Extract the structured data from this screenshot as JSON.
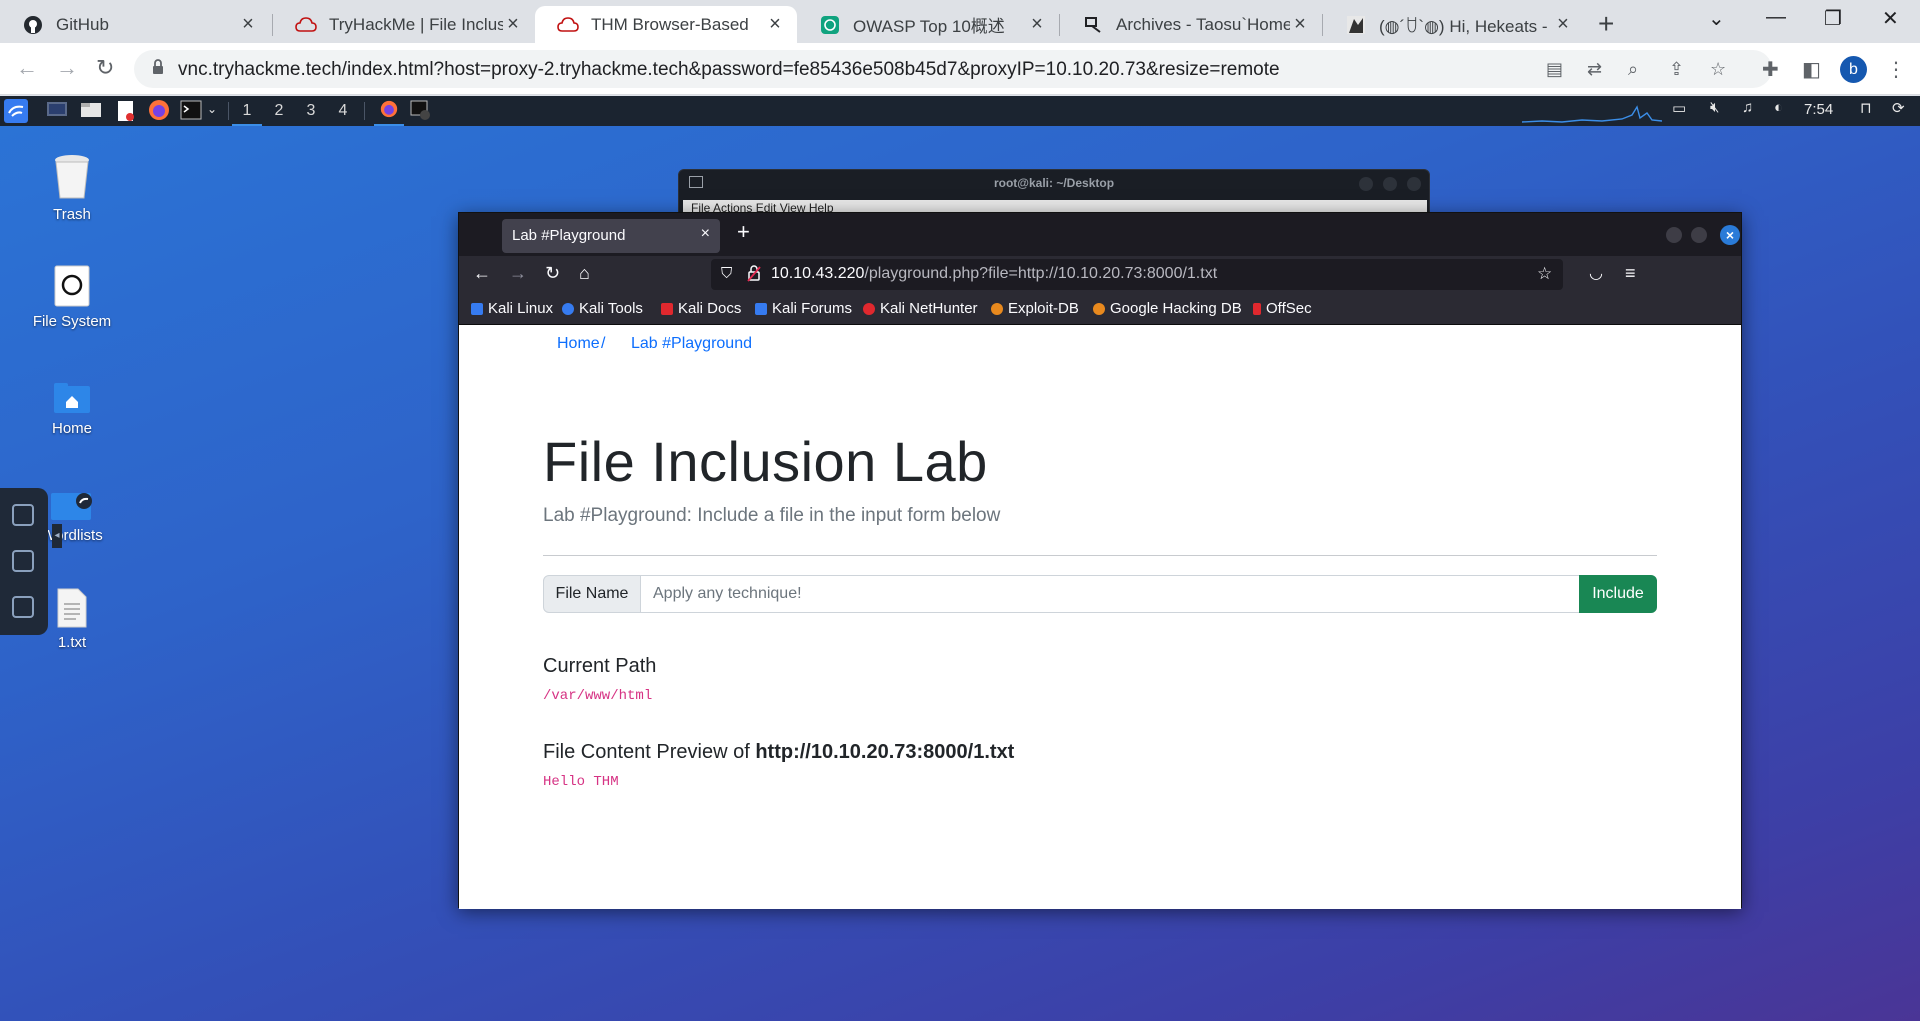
{
  "chrome": {
    "tabs": [
      {
        "label": "GitHub",
        "icon": "github-icon"
      },
      {
        "label": "TryHackMe | File Inclusion",
        "icon": "tryhackme-icon"
      },
      {
        "label": "THM Browser-Based",
        "icon": "tryhackme-icon"
      },
      {
        "label": "OWASP Top 10概述",
        "icon": "chatgpt-icon"
      },
      {
        "label": "Archives - Taosu`Home",
        "icon": "site-icon"
      },
      {
        "label": "(◍´ꇴ`◍) Hi, Hekeats - 【T",
        "icon": "avatar-icon"
      }
    ],
    "url": "vnc.tryhackme.tech/index.html?host=proxy-2.tryhackme.tech&password=fe85436e508b45d7&proxyIP=10.10.20.73&resize=remote",
    "profile_initial": "b"
  },
  "kali": {
    "workspaces": [
      "1",
      "2",
      "3",
      "4"
    ],
    "clock": "7:54",
    "desktop_icons": [
      {
        "label": "Trash"
      },
      {
        "label": "File System"
      },
      {
        "label": "Home"
      },
      {
        "label": "Wordlists"
      },
      {
        "label": "1.txt"
      }
    ],
    "terminal": {
      "title": "root@kali: ~/Desktop",
      "menu": "File   Actions   Edit   View   Help"
    }
  },
  "firefox": {
    "tab_label": "Lab #Playground",
    "url_host": "10.10.43.220",
    "url_path": "/playground.php?file=http://10.10.20.73:8000/1.txt",
    "bookmarks": [
      {
        "label": "Kali Linux",
        "color": "#367bf0"
      },
      {
        "label": "Kali Tools",
        "color": "#367bf0"
      },
      {
        "label": "Kali Docs",
        "color": "#e0282e"
      },
      {
        "label": "Kali Forums",
        "color": "#367bf0"
      },
      {
        "label": "Kali NetHunter",
        "color": "#e0282e"
      },
      {
        "label": "Exploit-DB",
        "color": "#e8891e"
      },
      {
        "label": "Google Hacking DB",
        "color": "#e8891e"
      },
      {
        "label": "OffSec",
        "color": "#e0282e"
      }
    ]
  },
  "page": {
    "breadcrumb": {
      "home": "Home",
      "separator": "/",
      "current": "Lab #Playground"
    },
    "title": "File Inclusion Lab",
    "lead": "Lab #Playground: Include a file in the input form below",
    "form": {
      "label": "File Name",
      "placeholder": "Apply any technique!",
      "value": "",
      "button": "Include"
    },
    "current_path": {
      "heading": "Current Path",
      "value": "/var/www/html"
    },
    "preview": {
      "heading_prefix": "File Content Preview of ",
      "heading_target": "http://10.10.20.73:8000/1.txt",
      "content": "Hello THM"
    }
  }
}
